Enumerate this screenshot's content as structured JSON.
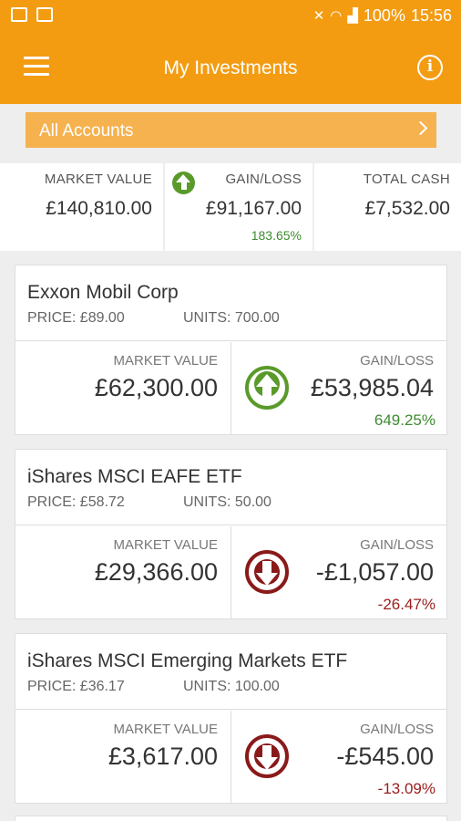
{
  "status_bar": {
    "left_icons": [
      "image-icon",
      "notification-image-icon"
    ],
    "right_icons": [
      "mute-icon",
      "wifi-icon",
      "signal-icon"
    ],
    "battery": "100%",
    "time": "15:56"
  },
  "app_bar": {
    "title": "My Investments",
    "menu_icon": "hamburger-menu-icon",
    "info_icon": "info-icon",
    "background_color": "#f39c12"
  },
  "accounts_selector": {
    "label": "All Accounts",
    "icon": "chevron-right-icon"
  },
  "summary": {
    "market_value_label": "MARKET VALUE",
    "market_value": "£140,810.00",
    "gain_loss_label": "GAIN/LOSS",
    "gain_loss": "£91,167.00",
    "gain_loss_pct": "183.65%",
    "gain_loss_direction": "up",
    "total_cash_label": "TOTAL CASH",
    "total_cash": "£7,532.00"
  },
  "holdings": [
    {
      "name": "Exxon Mobil Corp",
      "price": "PRICE: £89.00",
      "units": "UNITS: 700.00",
      "market_value_label": "MARKET VALUE",
      "market_value": "£62,300.00",
      "gain_loss_label": "GAIN/LOSS",
      "gain_loss": "£53,985.04",
      "gain_loss_pct": "649.25%",
      "direction": "up"
    },
    {
      "name": "iShares MSCI EAFE ETF",
      "price": "PRICE: £58.72",
      "units": "UNITS: 50.00",
      "market_value_label": "MARKET VALUE",
      "market_value": "£29,366.00",
      "gain_loss_label": "GAIN/LOSS",
      "gain_loss": "-£1,057.00",
      "gain_loss_pct": "-26.47%",
      "direction": "down"
    },
    {
      "name": "iShares MSCI Emerging Markets ETF",
      "price": "PRICE: £36.17",
      "units": "UNITS: 100.00",
      "market_value_label": "MARKET VALUE",
      "market_value": "£3,617.00",
      "gain_loss_label": "GAIN/LOSS",
      "gain_loss": "-£545.00",
      "gain_loss_pct": "-13.09%",
      "direction": "down"
    }
  ],
  "colors": {
    "accent": "#f39c12",
    "positive": "#3d8b2f",
    "negative": "#9b1c1c"
  }
}
